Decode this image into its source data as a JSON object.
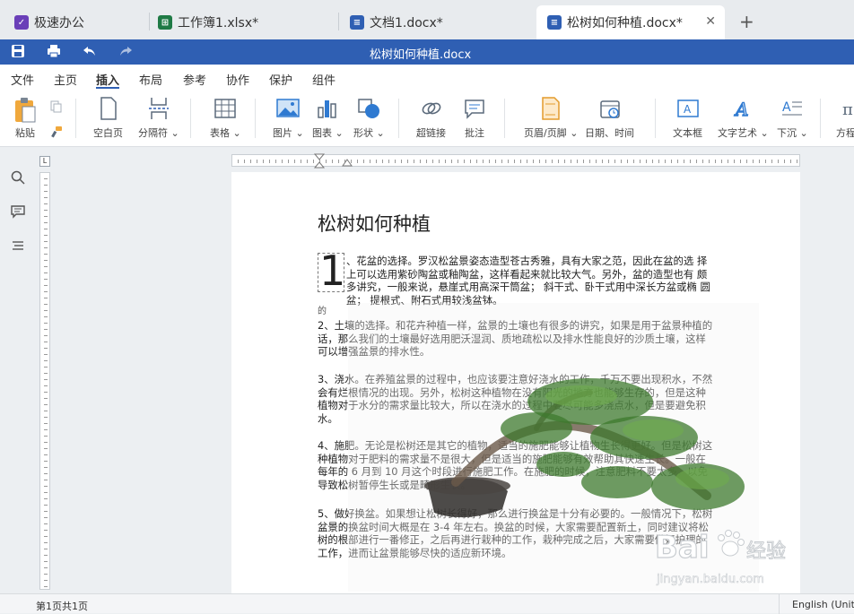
{
  "tabs": [
    {
      "label": "极速办公",
      "logo_color": "#6a3fb8",
      "logo_glyph": "✓"
    },
    {
      "label": "工作簿1.xlsx*",
      "logo_color": "#1f7a45",
      "logo_glyph": "⊞"
    },
    {
      "label": "文档1.docx*",
      "logo_color": "#2f5fb3",
      "logo_glyph": "≡"
    },
    {
      "label": "松树如何种植.docx*",
      "logo_color": "#2f5fb3",
      "logo_glyph": "≡"
    }
  ],
  "window": {
    "title": "松树如何种植.docx",
    "accent": "#2f5fb3"
  },
  "menu": [
    "文件",
    "主页",
    "插入",
    "布局",
    "参考",
    "协作",
    "保护",
    "组件"
  ],
  "ribbon": {
    "paste": "粘贴",
    "blank_page": "空白页",
    "page_break": "分隔符",
    "table": "表格",
    "image": "图片",
    "chart": "图表",
    "shape": "形状",
    "hyperlink": "超链接",
    "comment": "批注",
    "header_footer": "页眉/页脚",
    "datetime": "日期、时间",
    "textbox": "文本框",
    "wordart": "文字艺术",
    "dropcap": "下沉",
    "formula": "方程"
  },
  "ruler_corner": "L",
  "document": {
    "heading": "松树如何种植",
    "dropcap": "1",
    "p1": "、花盆的选择。罗汉松盆景姿态造型苍古秀雅，具有大家之范，因此在盆的选  择上可以选用紫砂陶盆或釉陶盆，这样看起来就比较大气。另外，盆的造型也有  颇多讲究，一般来说，悬崖式用高深干筒盆；  斜干式、卧干式用中深长方盆或椭  圆盆；  提根式、附石式用较浅盆钵。",
    "p1_tail": "的",
    "p2": "2、土壤的选择。和花卉种植一样，盆景的土壤也有很多的讲究，如果是用于盆景种植的话，那么我们的土壤最好选用肥沃湿润、质地疏松以及排水性能良好的沙质土壤，这样可以增强盆景的排水性。",
    "p3": "3、浇水。在养殖盆景的过程中，也应该要注意好浇水的工作，千万不要出现积水，不然会有烂根情况的出现。另外，松树这种植物在没有阳光的地方也能够生存的，但是这种植物对于水分的需求量比较大，所以在浇水的过程中要尽可能多浇点水，但是要避免积水。",
    "p4": "4、施肥。无论是松树还是其它的植物，适当的施肥能够让植物生长得更好。但是松树这种植物对于肥料的需求量不是很大，但是适当的施肥能够有效帮助其快速生长。一般在每年的 6 月到 10 月这个时段进行施肥工作。在施肥的时候，注意肥料不要太多，以免导致松树暂停生长或是畸形生长。",
    "p5": "5、做好换盆。如果想让松树长得好，那么进行换盆是十分有必要的。一般情况下，松树盆景的换盆时间大概是在 3-4 年左右。换盆的时候，大家需要配置新土，同时建议将松树的根部进行一番修正，之后再进行栽种的工作，栽种完成之后，大家需要做好护理的工作，进而让盆景能够尽快的适应新环境。"
  },
  "watermark": {
    "brand": "Bai",
    "brand2": "经验",
    "url": "jingyan.baidu.com"
  },
  "status": {
    "pages": "第1页共1页",
    "language": "English (United States)"
  }
}
